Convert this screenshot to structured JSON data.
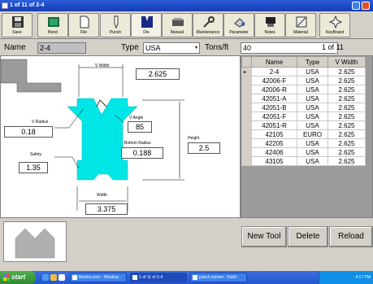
{
  "window": {
    "title": "1 of 11 of 2-4"
  },
  "toolbar": {
    "buttons": [
      {
        "label": "Save",
        "icon": "floppy-disk-icon"
      },
      {
        "label": "Bend",
        "icon": "bend-icon"
      },
      {
        "label": "File",
        "icon": "file-icon"
      },
      {
        "label": "Punch",
        "icon": "punch-icon"
      },
      {
        "label": "Die",
        "icon": "die-icon",
        "active": true
      },
      {
        "label": "Manual",
        "icon": "manual-icon"
      },
      {
        "label": "Maintenance",
        "icon": "wrench-icon"
      },
      {
        "label": "Parameter",
        "icon": "parameter-icon"
      },
      {
        "label": "Notes",
        "icon": "notes-icon"
      },
      {
        "label": "Material",
        "icon": "material-icon"
      },
      {
        "label": "KeyBoard",
        "icon": "keyboard-icon"
      }
    ]
  },
  "form": {
    "name_label": "Name",
    "name_value": "2-4",
    "type_label": "Type",
    "type_value": "USA",
    "tons_label": "Tons/ft",
    "tons_value": "40",
    "record_position": "1 of  11"
  },
  "drawing": {
    "v_width_label": "V Width",
    "v_width_value": "2.625",
    "v_radius_label": "V Radius",
    "v_radius_value": "0.18",
    "v_angle_label": "V Angle",
    "v_angle_value": "85",
    "bottom_radius_label": "Bottom Radius",
    "bottom_radius_value": "0.188",
    "height_label": "Height",
    "height_value": "2.5",
    "safety_label": "Safety",
    "safety_value": "1.35",
    "width_label": "Width",
    "width_value": "3.375"
  },
  "table": {
    "columns": [
      "Name",
      "Type",
      "V Width"
    ],
    "rows": [
      [
        "2-4",
        "USA",
        "2.625"
      ],
      [
        "42006-F",
        "USA",
        "2.625"
      ],
      [
        "42006-R",
        "USA",
        "2.625"
      ],
      [
        "42051-A",
        "USA",
        "2.625"
      ],
      [
        "42051-B",
        "USA",
        "2.625"
      ],
      [
        "42051-F",
        "USA",
        "2.625"
      ],
      [
        "42051-R",
        "USA",
        "2.625"
      ],
      [
        "42105",
        "EURO",
        "2.625"
      ],
      [
        "42205",
        "USA",
        "2.625"
      ],
      [
        "42406",
        "USA",
        "2.625"
      ],
      [
        "43105",
        "USA",
        "2.625"
      ]
    ],
    "current_row_marker": "▸"
  },
  "actions": {
    "new_tool": "New Tool",
    "delete": "Delete",
    "reload": "Reload"
  },
  "taskbar": {
    "start": "start",
    "tasks": [
      "Boston.com - Window...",
      "1 of 11 of 2-4",
      "punch screen - Paint"
    ],
    "clock": "4:17 PM"
  },
  "colors": {
    "die_fill": "#00e5e5",
    "titlebar": "#1c48c4",
    "die_button_icon": "#1a2a8a"
  }
}
